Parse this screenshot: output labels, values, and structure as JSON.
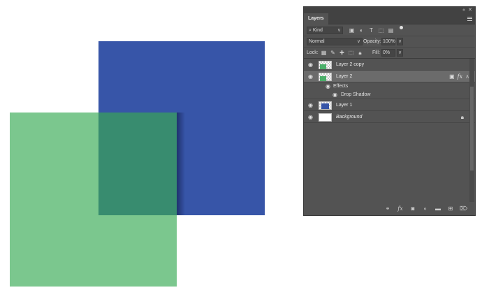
{
  "canvas": {
    "blue_color": "#3755a8",
    "green_color": "#7bc78e",
    "overlap_color": "#388c6f"
  },
  "panel": {
    "tab_label": "Layers",
    "filter": {
      "kind_label": "Kind",
      "icons": [
        "image-filter-icon",
        "adjustment-filter-icon",
        "type-filter-icon",
        "shape-filter-icon",
        "smart-object-filter-icon"
      ]
    },
    "blend": {
      "mode_label": "Normal",
      "opacity_label": "Opacity:",
      "opacity_value": "100%"
    },
    "lock": {
      "lock_label": "Lock:",
      "fill_label": "Fill:",
      "fill_value": "0%"
    },
    "layers": [
      {
        "name": "Layer 2 copy"
      },
      {
        "name": "Layer 2",
        "fx_badge": "fx"
      },
      {
        "name": "Layer 1"
      },
      {
        "name": "Background"
      }
    ],
    "effects": {
      "header": "Effects",
      "items": [
        "Drop Shadow"
      ]
    }
  }
}
